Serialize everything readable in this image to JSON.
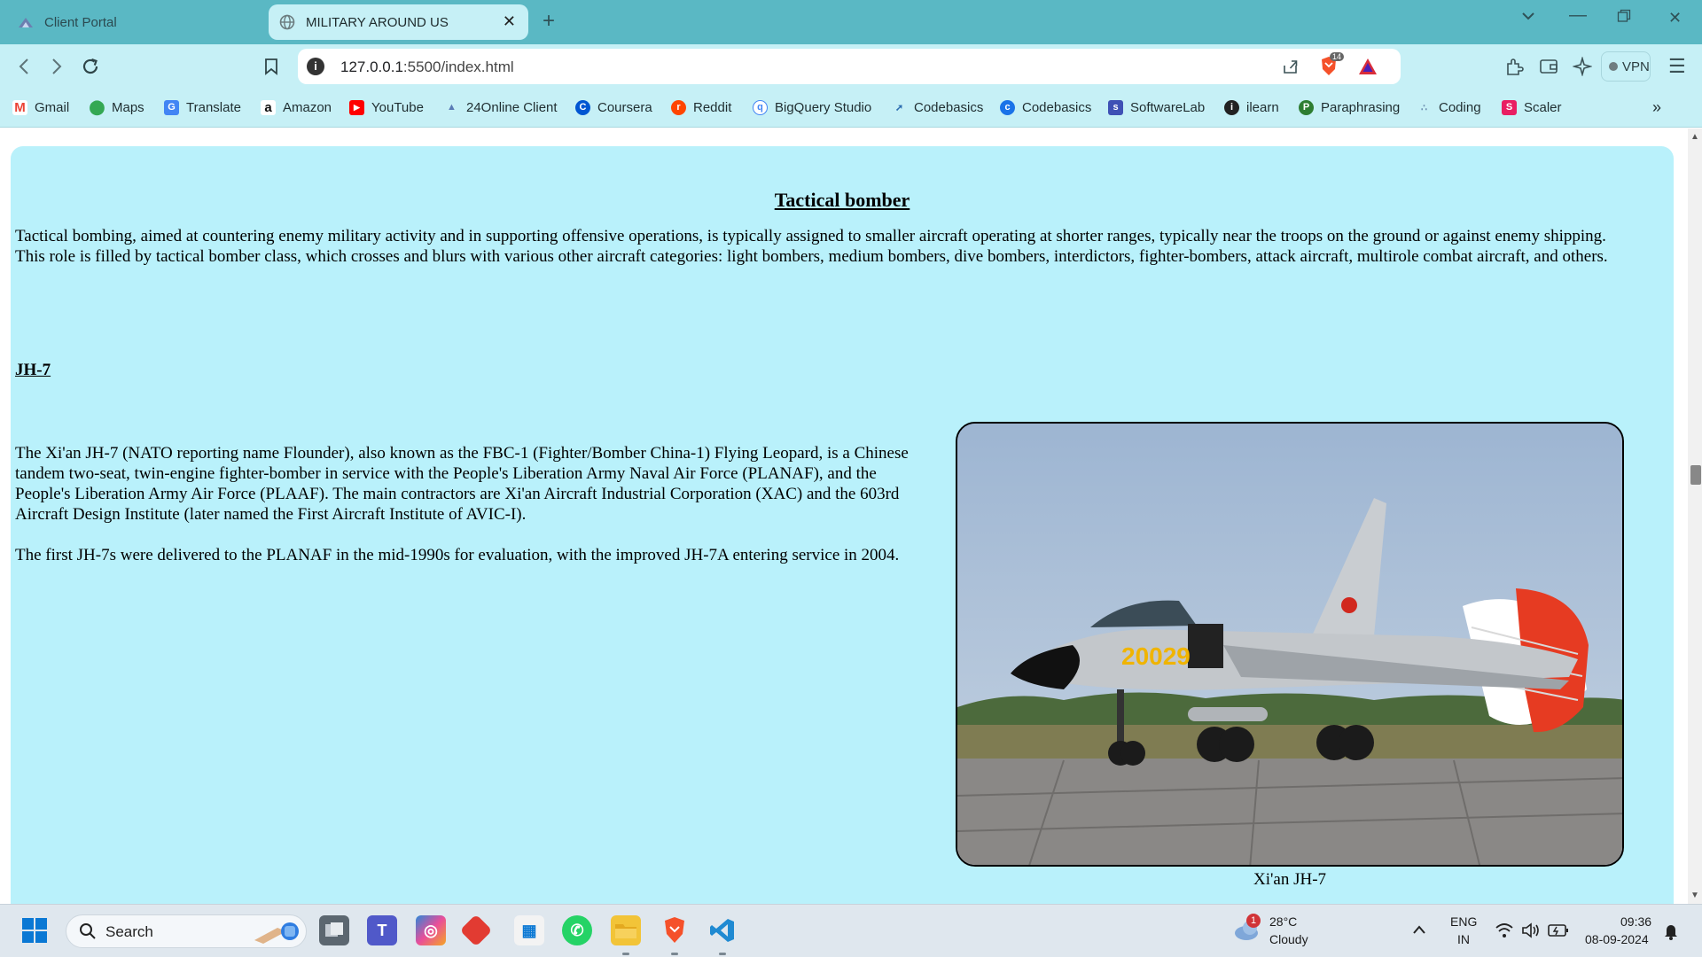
{
  "browser": {
    "tabs": [
      {
        "label": "Client Portal",
        "active": false
      },
      {
        "label": "MILITARY AROUND US",
        "active": true
      }
    ],
    "url": {
      "host": "127.0.0.1",
      "path": ":5500/index.html"
    },
    "brave_badge": "14",
    "vpn_label": "VPN",
    "bookmarks": [
      {
        "label": "Gmail",
        "icon": "gmail-icon",
        "color": "#ea4335"
      },
      {
        "label": "Maps",
        "icon": "maps-icon",
        "color": "#34a853"
      },
      {
        "label": "Translate",
        "icon": "translate-icon",
        "color": "#4285f4"
      },
      {
        "label": "Amazon",
        "icon": "amazon-icon",
        "color": "#111111"
      },
      {
        "label": "YouTube",
        "icon": "youtube-icon",
        "color": "#ff0000"
      },
      {
        "label": "24Online Client",
        "icon": "24online-icon",
        "color": "#5a7bb5"
      },
      {
        "label": "Coursera",
        "icon": "coursera-icon",
        "color": "#0056d2"
      },
      {
        "label": "Reddit",
        "icon": "reddit-icon",
        "color": "#ff4500"
      },
      {
        "label": "BigQuery Studio",
        "icon": "bigquery-icon",
        "color": "#4285f4"
      },
      {
        "label": "Codebasics",
        "icon": "codebasics-rocket-icon",
        "color": "#2b6cb0"
      },
      {
        "label": "Codebasics",
        "icon": "codebasics-icon",
        "color": "#1a73e8"
      },
      {
        "label": "SoftwareLab",
        "icon": "softwarelab-icon",
        "color": "#3f51b5"
      },
      {
        "label": "ilearn",
        "icon": "ilearn-icon",
        "color": "#222222"
      },
      {
        "label": "Paraphrasing",
        "icon": "paraphrasing-icon",
        "color": "#2e7d32"
      },
      {
        "label": "Coding",
        "icon": "coding-icon",
        "color": "#6d8fb0"
      },
      {
        "label": "Scaler",
        "icon": "scaler-icon",
        "color": "#e91e63"
      }
    ]
  },
  "page": {
    "section_title": "Tactical bomber",
    "intro": "Tactical bombing, aimed at countering enemy military activity and in supporting offensive operations, is typically assigned to smaller aircraft operating at shorter ranges, typically near the troops on the ground or against enemy shipping. This role is filled by tactical bomber class, which crosses and blurs with various other aircraft categories: light bombers, medium bombers, dive bombers, interdictors, fighter-bombers, attack aircraft, multirole combat aircraft, and others.",
    "aircraft_heading": "JH-7",
    "para1": "The Xi'an JH-7 (NATO reporting name Flounder), also known as the FBC-1 (Fighter/Bomber China-1) Flying Leopard, is a Chinese tandem two-seat, twin-engine fighter-bomber in service with the People's Liberation Army Naval Air Force (PLANAF), and the People's Liberation Army Air Force (PLAAF). The main contractors are Xi'an Aircraft Industrial Corporation (XAC) and the 603rd Aircraft Design Institute (later named the First Aircraft Institute of AVIC-I).",
    "para2": "The first JH-7s were delivered to the PLANAF in the mid-1990s for evaluation, with the improved JH-7A entering service in 2004.",
    "image_tail_number": "20029",
    "image_caption": "Xi'an JH-7"
  },
  "taskbar": {
    "search_label": "Search",
    "weather_badge": "1",
    "temperature": "28°C",
    "weather": "Cloudy",
    "lang_top": "ENG",
    "lang_bottom": "IN",
    "time": "09:36",
    "date": "08-09-2024"
  }
}
